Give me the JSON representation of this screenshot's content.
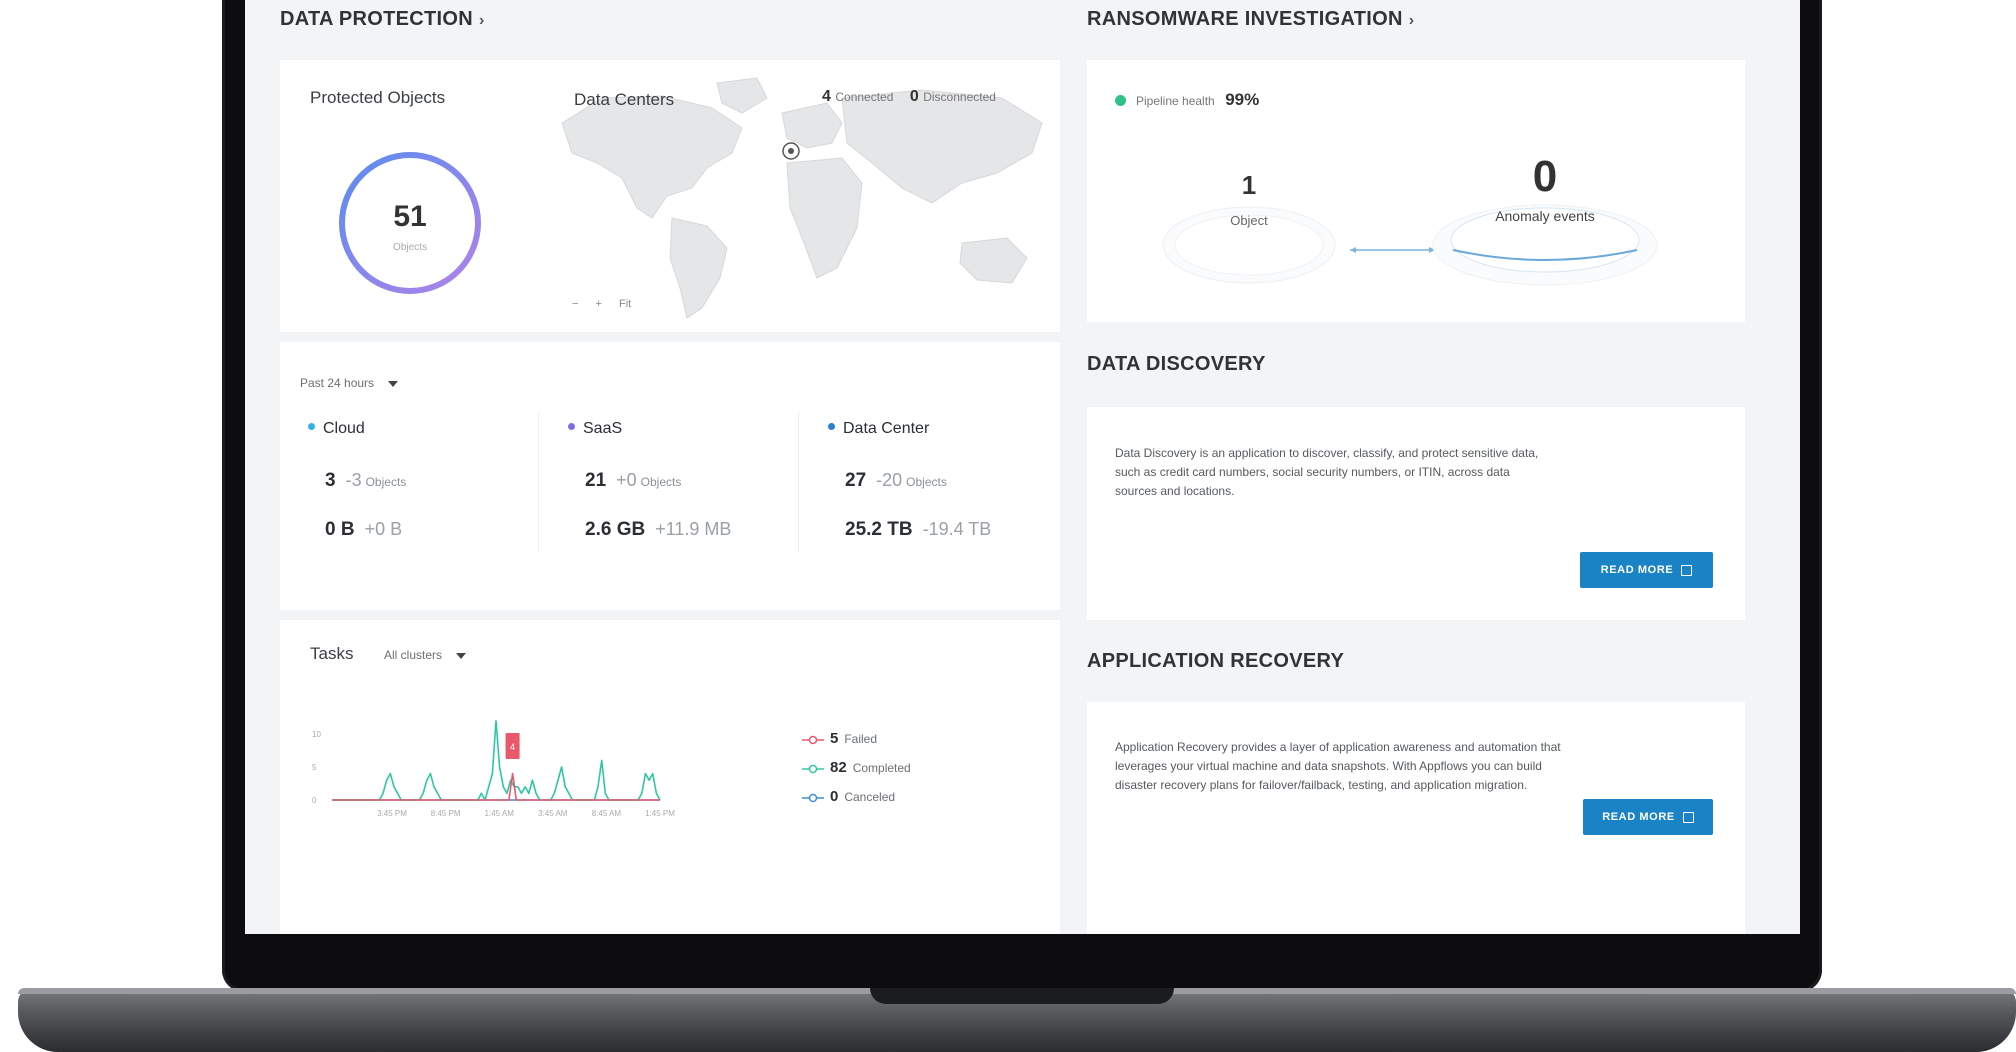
{
  "data_protection": {
    "title": "DATA PROTECTION",
    "protected_objects": {
      "label": "Protected Objects",
      "count": "51",
      "unit": "Objects",
      "ring_colors": [
        "#5b8def",
        "#b182e8"
      ]
    },
    "data_centers": {
      "label": "Data Centers",
      "connected_count": "4",
      "connected_label": "Connected",
      "disconnected_count": "0",
      "disconnected_label": "Disconnected",
      "zoom_out": "−",
      "zoom_in": "+",
      "fit": "Fit"
    },
    "time_filter": "Past 24 hours",
    "categories": [
      {
        "name": "Cloud",
        "color": "#2fb3e0",
        "objects": "3",
        "objects_delta": "-3",
        "objects_unit": "Objects",
        "size": "0 B",
        "size_delta": "+0 B"
      },
      {
        "name": "SaaS",
        "color": "#7b6fe0",
        "objects": "21",
        "objects_delta": "+0",
        "objects_unit": "Objects",
        "size": "2.6 GB",
        "size_delta": "+11.9 MB"
      },
      {
        "name": "Data Center",
        "color": "#2b7fd0",
        "objects": "27",
        "objects_delta": "-20",
        "objects_unit": "Objects",
        "size": "25.2 TB",
        "size_delta": "-19.4 TB"
      }
    ],
    "tasks": {
      "label": "Tasks",
      "cluster_filter": "All clusters",
      "legend": [
        {
          "count": "5",
          "label": "Failed",
          "color": "#e8596b"
        },
        {
          "count": "82",
          "label": "Completed",
          "color": "#2ec7a3"
        },
        {
          "count": "0",
          "label": "Canceled",
          "color": "#3d8fd6"
        }
      ],
      "tooltip_value": "4"
    }
  },
  "ransomware": {
    "title": "RANSOMWARE INVESTIGATION",
    "pipeline_label": "Pipeline health",
    "pipeline_value": "99%",
    "object_count": "1",
    "object_label": "Object",
    "anomaly_count": "0",
    "anomaly_label": "Anomaly events",
    "status_color": "#2ec28a"
  },
  "data_discovery": {
    "title": "DATA DISCOVERY",
    "description": "Data Discovery is an application to discover, classify, and protect sensitive data, such as credit card numbers, social security numbers, or ITIN, across data sources and locations.",
    "button": "READ MORE"
  },
  "application_recovery": {
    "title": "APPLICATION RECOVERY",
    "description": "Application Recovery provides a layer of application awareness and automation that leverages your virtual machine and data snapshots. With Appflows you can build disaster recovery plans for failover/failback, testing, and application migration.",
    "button": "READ MORE"
  },
  "chart_data": {
    "type": "line",
    "title": "Tasks",
    "ylim": [
      0,
      15
    ],
    "y_ticks": [
      "0",
      "5",
      "10"
    ],
    "x_ticks": [
      "3:45 PM",
      "8:45 PM",
      "1:45 AM",
      "3:45 AM",
      "8:45 AM",
      "1:45 PM"
    ],
    "series": [
      {
        "name": "Failed",
        "color": "#e8596b",
        "values": [
          0,
          0,
          0,
          0,
          0,
          0,
          0,
          0,
          0,
          0,
          0,
          0,
          0,
          0,
          0,
          0,
          0,
          0,
          0,
          0,
          0,
          0,
          0,
          0,
          0,
          0,
          0,
          0,
          0,
          0,
          0,
          0,
          0,
          0,
          0,
          0,
          0,
          0,
          0,
          0,
          0,
          0,
          0,
          0,
          0,
          0,
          0,
          0,
          0,
          4,
          0,
          0,
          0,
          0,
          0,
          0,
          0,
          0,
          0,
          0,
          0,
          0,
          0,
          0,
          0,
          0,
          0,
          0,
          0,
          0,
          0,
          0,
          0,
          0,
          0,
          0,
          0,
          0,
          0,
          0,
          0,
          0,
          0,
          0,
          0,
          0,
          0,
          0,
          0,
          0
        ]
      },
      {
        "name": "Completed",
        "color": "#2ec7a3",
        "values": [
          0,
          0,
          0,
          0,
          0,
          0,
          0,
          0,
          0,
          0,
          0,
          0,
          0,
          0,
          1,
          3,
          4,
          2,
          1,
          0,
          0,
          0,
          0,
          0,
          0,
          1,
          3,
          4,
          2,
          1,
          0,
          0,
          0,
          0,
          0,
          0,
          0,
          0,
          0,
          0,
          0,
          1,
          0,
          2,
          4,
          12,
          5,
          2,
          1,
          3,
          2,
          2,
          1,
          2,
          1,
          3,
          1,
          0,
          0,
          0,
          0,
          1,
          3,
          5,
          2,
          1,
          0,
          0,
          0,
          0,
          0,
          0,
          0,
          2,
          6,
          1,
          0,
          0,
          0,
          0,
          0,
          0,
          0,
          0,
          0,
          1,
          4,
          3,
          4,
          1,
          0
        ]
      },
      {
        "name": "Canceled",
        "color": "#3d8fd6",
        "values": [
          0,
          0,
          0,
          0,
          0,
          0,
          0,
          0,
          0,
          0,
          0,
          0,
          0,
          0,
          0,
          0,
          0,
          0,
          0,
          0,
          0,
          0,
          0,
          0,
          0,
          0,
          0,
          0,
          0,
          0,
          0,
          0,
          0,
          0,
          0,
          0,
          0,
          0,
          0,
          0,
          0,
          0,
          0,
          0,
          0,
          0,
          0,
          0,
          0,
          0,
          0,
          0,
          0,
          0,
          0,
          0,
          0,
          0,
          0,
          0,
          0,
          0,
          0,
          0,
          0,
          0,
          0,
          0,
          0,
          0,
          0,
          0,
          0,
          0,
          0,
          0,
          0,
          0,
          0,
          0,
          0,
          0,
          0,
          0,
          0,
          0,
          0,
          0,
          0,
          0
        ]
      }
    ]
  }
}
